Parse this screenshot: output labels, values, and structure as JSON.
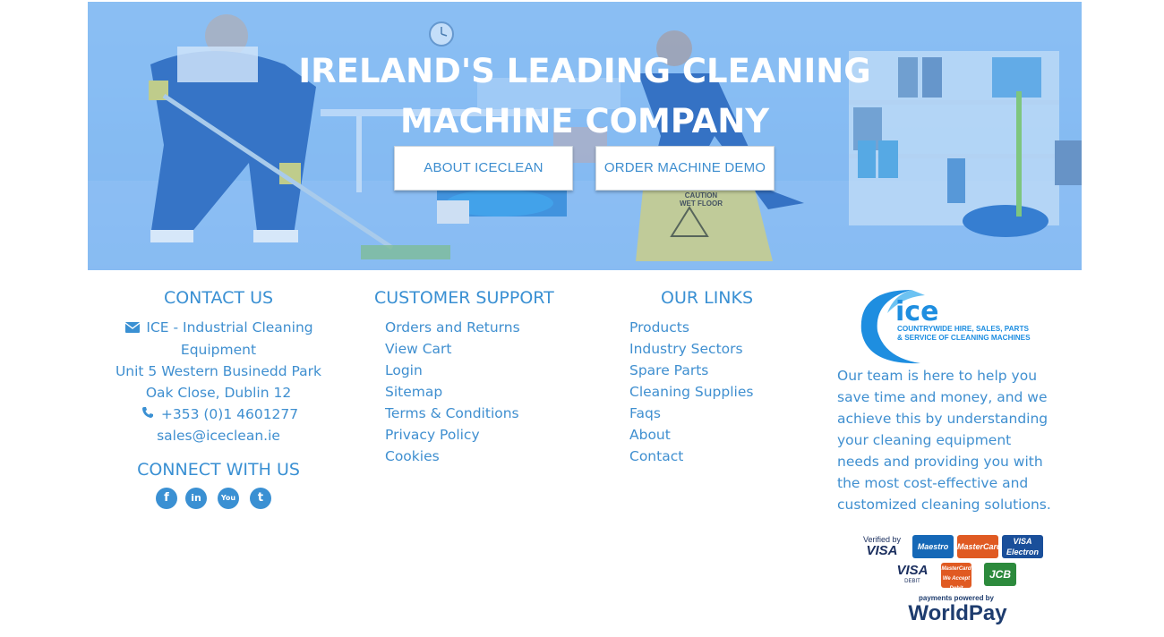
{
  "hero": {
    "title_line1": "IRELAND'S LEADING CLEANING",
    "title_line2": "MACHINE COMPANY",
    "about_button": "ABOUT ICECLEAN",
    "demo_button": "ORDER MACHINE DEMO",
    "caution_sign_line1": "CAUTION",
    "caution_sign_line2": "WET FLOOR"
  },
  "contact": {
    "title": "CONTACT US",
    "company": "ICE - Industrial Cleaning",
    "company_line2": "Equipment",
    "address1": "Unit 5 Western Businedd Park",
    "address2": "Oak Close, Dublin 12",
    "phone": "+353 (0)1 4601277",
    "email": "sales@iceclean.ie",
    "icons": [
      "envelope-icon",
      "phone-icon"
    ]
  },
  "connect": {
    "title": "CONNECT WITH US",
    "icons": [
      "facebook-icon",
      "linkedin-icon",
      "youtube-icon",
      "twitter-icon"
    ],
    "glyphs": [
      "f",
      "in",
      "You",
      "t"
    ]
  },
  "support": {
    "title": "CUSTOMER SUPPORT",
    "items": [
      "Orders and Returns",
      "View Cart",
      "Login",
      "Sitemap",
      "Terms & Conditions",
      "Privacy Policy",
      "Cookies"
    ]
  },
  "links": {
    "title": "OUR LINKS",
    "items": [
      "Products",
      "Industry Sectors",
      "Spare Parts",
      "Cleaning Supplies",
      "Faqs",
      "About",
      "Contact"
    ]
  },
  "about": {
    "logo_text": "ice",
    "logo_tagline1": "COUNTRYWIDE HIRE, SALES, PARTS",
    "logo_tagline2": "& SERVICE OF CLEANING MACHINES",
    "text": "Our team is here to help you save time and money, and we achieve this by understanding your cleaning equipment needs and providing you with the most cost-effective and customized cleaning solutions."
  },
  "payments": {
    "verified_by": "Verified by",
    "visa": "VISA",
    "maestro": "Maestro",
    "mastercard": "MasterCard",
    "visa_electron_1": "VISA",
    "visa_electron_2": "Electron",
    "visa_debit": "VISA",
    "debit": "DEBIT",
    "mastercard_small": "MasterCard",
    "we_accept": "We Accept Debit",
    "jcb": "JCB",
    "powered_by": "payments powered by",
    "worldpay": "WorldPay"
  },
  "colors": {
    "accent": "#3a90d3",
    "hero_overlay": "#7ab3f1",
    "worldpay_navy": "#1e3c6e"
  }
}
